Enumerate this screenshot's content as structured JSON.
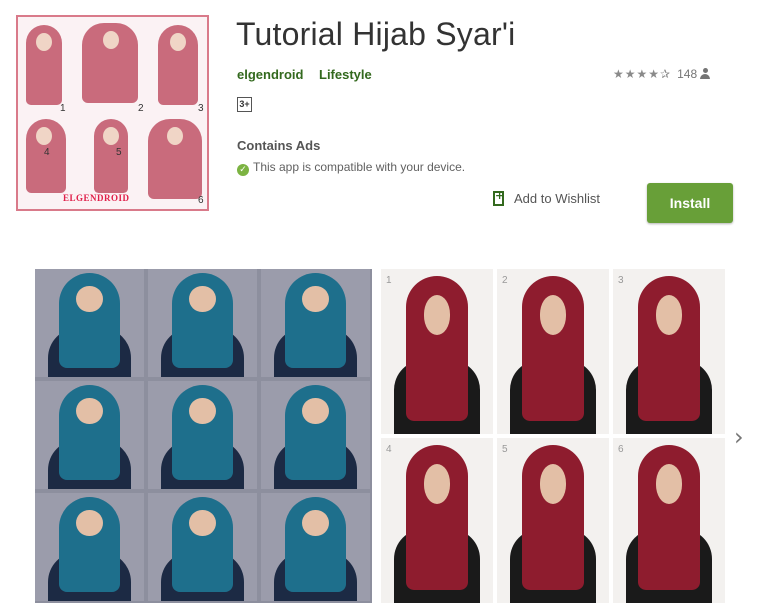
{
  "app": {
    "title": "Tutorial Hijab Syar'i",
    "developer": "elgendroid",
    "category": "Lifestyle",
    "rating_stars": "★★★★✰",
    "rating_value": 4.5,
    "review_count": "148",
    "content_rating": "3+",
    "contains_ads": "Contains Ads",
    "compatibility": "This app is compatible with your device.",
    "wishlist_label": "Add to Wishlist",
    "install_label": "Install"
  },
  "icon": {
    "steps": [
      "1",
      "2",
      "3",
      "4",
      "5",
      "6"
    ],
    "brand": "ELGENDROID"
  },
  "screenshots": [
    {
      "steps": []
    },
    {
      "steps": [
        "1",
        "2",
        "3",
        "4",
        "5",
        "6"
      ]
    }
  ],
  "colors": {
    "accent_green": "#689f38",
    "link_green": "#33691e",
    "icon_border": "#d97a8a",
    "hijab_pink": "#c96b7c",
    "hijab_teal": "#1e6f8c",
    "hijab_maroon": "#8e1c2e"
  },
  "icons": [
    "person-icon",
    "check-circle-icon",
    "bookmark-add-icon",
    "chevron-right-icon"
  ]
}
